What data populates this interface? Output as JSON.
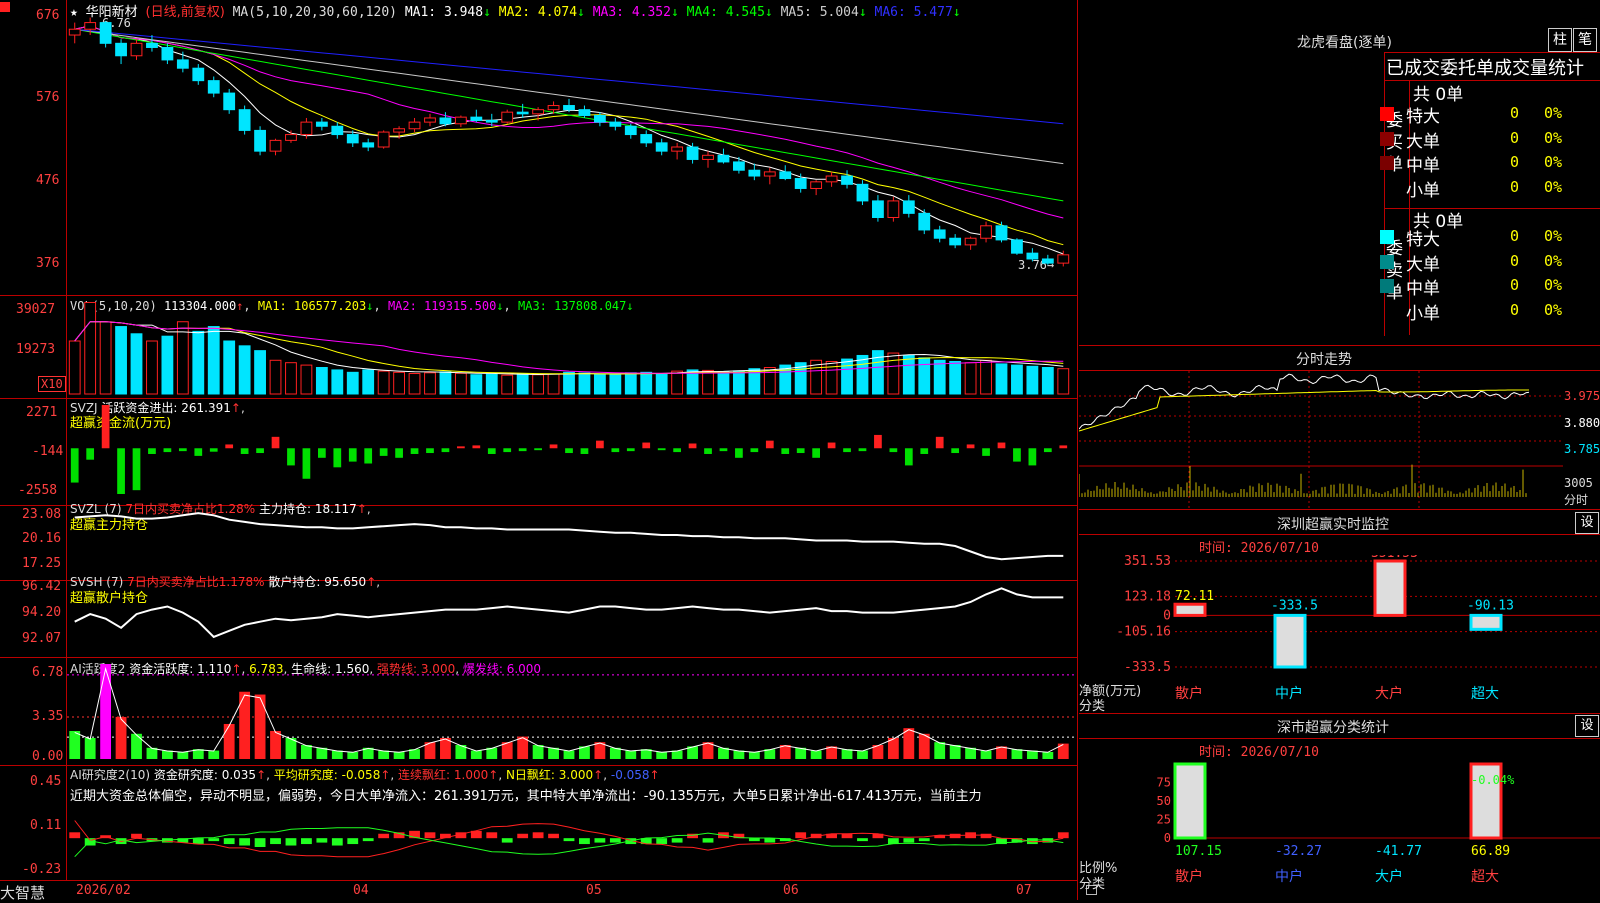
{
  "colors": {
    "up": "#ff2020",
    "down": "#00e5ff",
    "ma1": "#ffffff",
    "ma2": "#ffff00",
    "ma3": "#ff00ff",
    "ma4": "#00ff00",
    "ma5": "#c8c8c8",
    "ma6": "#2020ff",
    "grid": "#b00000"
  },
  "header": {
    "star": "★",
    "name": "华阳新材",
    "period": "(日线,前复权)",
    "ma_cfg": "MA(5,10,20,30,60,120)",
    "ma1": "MA1: 3.948",
    "ma2": "MA2: 4.074",
    "ma3": "MA3: 4.352",
    "ma4": "MA4: 4.545",
    "ma5": "MA5: 5.004",
    "ma6": "MA6: 5.477",
    "arrow_down": "↓"
  },
  "price_axis": [
    "676",
    "576",
    "476",
    "376"
  ],
  "price_high_label": "6.76",
  "price_low_label": "3.76",
  "vol_header": {
    "cfg": "VOL(5,10,20)",
    "v": "113304.000",
    "ma1": "MA1: 106577.203",
    "ma2": "MA2: 119315.500",
    "ma3": "MA3: 137808.047"
  },
  "vol_axis": [
    "39027",
    "19273"
  ],
  "vol_unit": "X10",
  "svzj": {
    "title": "SVZJ",
    "label": "活跃资金进出: 261.391",
    "sub": "超赢资金流(万元)",
    "axis": [
      "2271",
      "-144",
      "-2558"
    ]
  },
  "svzl": {
    "title": "SVZL (7)",
    "desc": "7日内买卖净占比1.28%",
    "hold": "主力持仓: 18.117",
    "sub": "超赢主力持仓",
    "axis": [
      "23.08",
      "20.16",
      "17.25"
    ]
  },
  "svsh": {
    "title": "SVSH (7)",
    "desc": "7日内买卖净占比1.178%",
    "hold": "散户持仓: 95.650",
    "sub": "超赢散户持仓",
    "axis": [
      "96.42",
      "94.20",
      "92.07"
    ]
  },
  "ai1": {
    "title": "AI活跃度2",
    "a": "资金活跃度: 1.110",
    "b": "6.783",
    "c": "生命线: 1.560",
    "d": "强势线: 3.000",
    "e": "爆发线: 6.000",
    "axis": [
      "6.78",
      "3.35",
      "0.00"
    ]
  },
  "ai2": {
    "title": "AI研究度2(10)",
    "a": "资金研究度: 0.035",
    "b": "平均研究度: -0.058",
    "c": "连续飘红: 1.000",
    "d": "N日飘红: 3.000",
    "e": "-0.058",
    "axis": [
      "0.45",
      "0.11",
      "-0.23"
    ],
    "commentary": "近期大资金总体偏空，异动不明显，偏弱势，今日大单净流入：261.391万元，其中特大单净流出：-90.135万元，大单5日累计净出-617.413万元，当前主力"
  },
  "date_axis": [
    "2026/02",
    "04",
    "05",
    "06",
    "07"
  ],
  "brand": "大智慧",
  "right_panel": {
    "lhb_title": "龙虎看盘(逐单)",
    "tab1": "柱",
    "tab2": "笔",
    "stats_title": "已成交委托单成交量统计",
    "buy_header": "共 0单",
    "buy_side": "委买单",
    "sell_header": "共 0单",
    "sell_side": "委卖单",
    "rows": [
      "特大",
      "大单",
      "中单",
      "小单"
    ],
    "zero": "0",
    "pct": "0%",
    "fenshi_title": "分时走势",
    "fenshi_axis": [
      "3.975",
      "3.880",
      "3.785"
    ],
    "fenshi_vol": "3005",
    "fenshi_unit": "分时",
    "monitor_title": "深圳超赢实时监控",
    "set": "设",
    "monitor_time": "时间: 2026/07/10",
    "monitor_axis": [
      "351.53",
      "123.18",
      "0",
      "-105.16",
      "-333.5"
    ],
    "monitor_side_label": "净额(万元)",
    "monitor_cat_label": "分类",
    "cls_title": "深市超赢分类统计",
    "cls_time": "时间: 2026/07/10",
    "cls_axis": [
      "75",
      "50",
      "25",
      "0"
    ],
    "cls_side_label": "比例%",
    "cls_cat_label": "分类",
    "cls_top_label": "-0.04%"
  },
  "chart_data": [
    {
      "type": "candlestick",
      "name": "价格",
      "xlabel": "",
      "ylabel": "",
      "ylim": [
        3.5,
        6.9
      ],
      "high": 6.76,
      "low": 3.76,
      "ohlc": [
        [
          6.55,
          6.7,
          6.45,
          6.62
        ],
        [
          6.62,
          6.76,
          6.55,
          6.7
        ],
        [
          6.7,
          6.72,
          6.4,
          6.45
        ],
        [
          6.45,
          6.5,
          6.2,
          6.3
        ],
        [
          6.3,
          6.5,
          6.25,
          6.45
        ],
        [
          6.45,
          6.55,
          6.35,
          6.4
        ],
        [
          6.4,
          6.45,
          6.2,
          6.25
        ],
        [
          6.25,
          6.35,
          6.1,
          6.15
        ],
        [
          6.15,
          6.2,
          5.95,
          6.0
        ],
        [
          6.0,
          6.05,
          5.8,
          5.85
        ],
        [
          5.85,
          5.9,
          5.6,
          5.65
        ],
        [
          5.65,
          5.7,
          5.35,
          5.4
        ],
        [
          5.4,
          5.45,
          5.1,
          5.15
        ],
        [
          5.15,
          5.3,
          5.1,
          5.28
        ],
        [
          5.28,
          5.4,
          5.25,
          5.35
        ],
        [
          5.35,
          5.55,
          5.3,
          5.5
        ],
        [
          5.5,
          5.55,
          5.4,
          5.45
        ],
        [
          5.45,
          5.5,
          5.3,
          5.35
        ],
        [
          5.35,
          5.4,
          5.2,
          5.25
        ],
        [
          5.25,
          5.3,
          5.15,
          5.2
        ],
        [
          5.2,
          5.4,
          5.18,
          5.38
        ],
        [
          5.38,
          5.45,
          5.3,
          5.42
        ],
        [
          5.42,
          5.55,
          5.38,
          5.5
        ],
        [
          5.5,
          5.6,
          5.45,
          5.55
        ],
        [
          5.55,
          5.62,
          5.45,
          5.48
        ],
        [
          5.48,
          5.58,
          5.44,
          5.56
        ],
        [
          5.56,
          5.65,
          5.5,
          5.52
        ],
        [
          5.52,
          5.6,
          5.45,
          5.5
        ],
        [
          5.5,
          5.65,
          5.48,
          5.62
        ],
        [
          5.62,
          5.72,
          5.55,
          5.6
        ],
        [
          5.6,
          5.68,
          5.52,
          5.65
        ],
        [
          5.65,
          5.75,
          5.6,
          5.7
        ],
        [
          5.7,
          5.78,
          5.62,
          5.65
        ],
        [
          5.65,
          5.7,
          5.55,
          5.58
        ],
        [
          5.58,
          5.62,
          5.45,
          5.5
        ],
        [
          5.5,
          5.55,
          5.4,
          5.45
        ],
        [
          5.45,
          5.48,
          5.3,
          5.35
        ],
        [
          5.35,
          5.4,
          5.2,
          5.25
        ],
        [
          5.25,
          5.3,
          5.1,
          5.15
        ],
        [
          5.15,
          5.25,
          5.05,
          5.2
        ],
        [
          5.2,
          5.25,
          5.0,
          5.05
        ],
        [
          5.05,
          5.15,
          4.95,
          5.1
        ],
        [
          5.1,
          5.18,
          5.0,
          5.02
        ],
        [
          5.02,
          5.08,
          4.88,
          4.92
        ],
        [
          4.92,
          5.0,
          4.8,
          4.85
        ],
        [
          4.85,
          4.95,
          4.75,
          4.9
        ],
        [
          4.9,
          4.98,
          4.8,
          4.82
        ],
        [
          4.82,
          4.88,
          4.65,
          4.7
        ],
        [
          4.7,
          4.8,
          4.62,
          4.78
        ],
        [
          4.78,
          4.9,
          4.72,
          4.85
        ],
        [
          4.85,
          4.92,
          4.7,
          4.75
        ],
        [
          4.75,
          4.8,
          4.5,
          4.55
        ],
        [
          4.55,
          4.62,
          4.3,
          4.35
        ],
        [
          4.35,
          4.6,
          4.3,
          4.55
        ],
        [
          4.55,
          4.62,
          4.35,
          4.4
        ],
        [
          4.4,
          4.45,
          4.15,
          4.2
        ],
        [
          4.2,
          4.25,
          4.05,
          4.1
        ],
        [
          4.1,
          4.15,
          3.98,
          4.02
        ],
        [
          4.02,
          4.12,
          3.96,
          4.1
        ],
        [
          4.1,
          4.3,
          4.05,
          4.25
        ],
        [
          4.25,
          4.3,
          4.05,
          4.08
        ],
        [
          4.08,
          4.1,
          3.9,
          3.92
        ],
        [
          3.92,
          3.98,
          3.82,
          3.85
        ],
        [
          3.85,
          3.9,
          3.78,
          3.8
        ],
        [
          3.8,
          3.95,
          3.76,
          3.9
        ]
      ]
    },
    {
      "type": "bar",
      "name": "VOL",
      "xlabel": "",
      "ylabel": "",
      "ylim": [
        0,
        39027
      ],
      "values": [
        22000,
        38000,
        30000,
        28000,
        25000,
        22000,
        24000,
        30000,
        26000,
        28000,
        22000,
        20000,
        18000,
        14000,
        13000,
        12000,
        11000,
        10000,
        9000,
        10000,
        9500,
        9000,
        8500,
        8800,
        9200,
        8600,
        8000,
        8200,
        7800,
        8500,
        8000,
        8300,
        9000,
        8700,
        8200,
        8000,
        8800,
        9000,
        8500,
        9500,
        10000,
        9800,
        9200,
        9600,
        10500,
        11000,
        12000,
        13000,
        14000,
        13500,
        14500,
        16000,
        18000,
        17000,
        16000,
        15000,
        14000,
        13500,
        13000,
        14000,
        12500,
        12000,
        11500,
        11000,
        10500
      ],
      "up": [
        1,
        1,
        1,
        0,
        0,
        1,
        0,
        1,
        0,
        0,
        0,
        0,
        0,
        1,
        1,
        1,
        0,
        0,
        0,
        0,
        1,
        1,
        1,
        1,
        0,
        1,
        0,
        0,
        1,
        0,
        1,
        1,
        0,
        0,
        0,
        0,
        0,
        0,
        0,
        1,
        0,
        1,
        0,
        0,
        0,
        1,
        0,
        0,
        1,
        1,
        0,
        0,
        0,
        1,
        0,
        0,
        0,
        0,
        1,
        1,
        0,
        0,
        0,
        0,
        1
      ]
    },
    {
      "type": "bar",
      "name": "SVZJ",
      "ylim": [
        -2558,
        2271
      ],
      "values": [
        -1800,
        -600,
        2271,
        -2400,
        -2200,
        -300,
        -200,
        -150,
        -400,
        -180,
        200,
        -300,
        -250,
        600,
        -900,
        -1600,
        -500,
        -1000,
        -700,
        -800,
        -400,
        -500,
        -300,
        -250,
        -200,
        100,
        150,
        -300,
        -200,
        -150,
        -100,
        200,
        -250,
        -300,
        400,
        -200,
        -150,
        300,
        -100,
        -200,
        250,
        -300,
        -150,
        -500,
        -200,
        400,
        -300,
        -250,
        -500,
        300,
        -200,
        -150,
        700,
        -200,
        -900,
        -300,
        600,
        -250,
        200,
        -400,
        300,
        -700,
        -900,
        -200,
        150
      ]
    },
    {
      "type": "line",
      "name": "SVZL",
      "ylim": [
        17.25,
        23.08
      ],
      "values": [
        22.4,
        22.5,
        22.6,
        22.5,
        22.3,
        22.3,
        22.4,
        22.6,
        22.8,
        22.6,
        22.2,
        22.0,
        21.8,
        21.7,
        21.6,
        21.5,
        21.5,
        21.4,
        21.4,
        21.5,
        21.6,
        21.7,
        21.8,
        21.7,
        21.5,
        21.5,
        21.4,
        21.4,
        21.3,
        21.3,
        21.3,
        21.3,
        21.3,
        21.2,
        21.1,
        21.0,
        21.0,
        20.9,
        20.8,
        20.8,
        20.7,
        20.7,
        20.6,
        20.6,
        20.5,
        20.5,
        20.5,
        20.4,
        20.3,
        20.3,
        20.3,
        20.2,
        20.2,
        20.2,
        20.1,
        20.0,
        20.0,
        19.8,
        19.3,
        18.8,
        18.6,
        18.7,
        18.8,
        18.9,
        18.9
      ]
    },
    {
      "type": "line",
      "name": "SVSH",
      "ylim": [
        92.07,
        96.42
      ],
      "values": [
        94.0,
        94.5,
        94.2,
        93.6,
        94.5,
        94.8,
        95.0,
        94.6,
        94.0,
        93.0,
        93.4,
        93.8,
        94.0,
        94.2,
        94.1,
        94.2,
        94.3,
        94.5,
        94.4,
        94.3,
        94.4,
        94.5,
        94.6,
        94.7,
        94.8,
        94.8,
        94.8,
        94.9,
        95.0,
        94.9,
        94.8,
        94.7,
        94.6,
        94.8,
        95.0,
        95.0,
        94.9,
        94.8,
        94.8,
        94.9,
        95.0,
        94.9,
        94.8,
        94.8,
        94.7,
        94.6,
        94.7,
        94.8,
        94.9,
        94.7,
        94.7,
        94.6,
        94.6,
        94.6,
        94.7,
        94.8,
        94.9,
        95.0,
        95.3,
        95.8,
        96.2,
        95.8,
        95.6,
        95.6,
        95.6
      ]
    },
    {
      "type": "bar",
      "name": "AI活跃度2",
      "ylim": [
        0,
        6.78
      ],
      "values": [
        2.0,
        1.5,
        6.78,
        3.0,
        1.8,
        0.8,
        0.6,
        0.5,
        0.7,
        0.6,
        2.5,
        4.8,
        4.6,
        2.0,
        1.5,
        1.0,
        0.8,
        0.6,
        0.5,
        0.8,
        0.6,
        0.5,
        0.7,
        1.2,
        1.5,
        1.0,
        0.6,
        0.8,
        1.2,
        1.6,
        1.0,
        0.8,
        0.6,
        0.9,
        1.2,
        0.8,
        0.6,
        0.7,
        0.5,
        0.6,
        0.9,
        1.2,
        0.8,
        0.6,
        0.5,
        0.7,
        1.0,
        0.8,
        0.6,
        0.9,
        0.7,
        0.6,
        1.0,
        1.5,
        2.2,
        1.8,
        1.2,
        1.0,
        0.8,
        0.6,
        0.9,
        0.7,
        0.6,
        0.5,
        1.1
      ],
      "up": [
        0,
        0,
        1,
        1,
        0,
        0,
        0,
        0,
        0,
        0,
        1,
        1,
        1,
        1,
        0,
        0,
        0,
        0,
        0,
        0,
        0,
        0,
        0,
        1,
        1,
        0,
        0,
        0,
        1,
        1,
        0,
        0,
        0,
        0,
        1,
        0,
        0,
        0,
        0,
        0,
        0,
        1,
        0,
        0,
        0,
        0,
        1,
        0,
        0,
        1,
        0,
        0,
        1,
        1,
        1,
        1,
        0,
        0,
        0,
        0,
        1,
        0,
        0,
        0,
        1
      ]
    },
    {
      "type": "bar",
      "name": "AI研究度2",
      "ylim": [
        -0.23,
        0.45
      ],
      "values": [
        0.04,
        -0.05,
        0.02,
        -0.04,
        0.03,
        -0.02,
        -0.03,
        -0.03,
        -0.04,
        -0.02,
        -0.04,
        -0.05,
        -0.06,
        -0.04,
        -0.05,
        -0.04,
        -0.03,
        -0.05,
        -0.04,
        -0.02,
        0.03,
        0.04,
        0.05,
        0.04,
        0.03,
        0.04,
        0.05,
        0.04,
        -0.03,
        0.03,
        0.04,
        0.03,
        -0.02,
        -0.04,
        -0.03,
        -0.03,
        -0.04,
        -0.04,
        -0.04,
        -0.03,
        0.03,
        -0.03,
        0.04,
        0.03,
        -0.02,
        -0.03,
        -0.02,
        0.04,
        0.03,
        0.03,
        0.03,
        -0.02,
        0.03,
        -0.04,
        -0.03,
        -0.02,
        0.02,
        0.03,
        0.04,
        0.03,
        -0.04,
        -0.03,
        -0.04,
        -0.03,
        0.04
      ]
    },
    {
      "type": "bar",
      "name": "深圳超赢实时监控",
      "categories": [
        "散户",
        "中户",
        "大户",
        "超大"
      ],
      "values": [
        72.11,
        -333.5,
        351.53,
        -90.13
      ],
      "ylim": [
        -333.5,
        351.53
      ]
    },
    {
      "type": "bar",
      "name": "深市超赢分类统计",
      "categories": [
        "散户",
        "中户",
        "大户",
        "超大"
      ],
      "values": [
        107.15,
        -32.27,
        -41.77,
        66.89
      ],
      "ylim": [
        0,
        100
      ]
    }
  ]
}
